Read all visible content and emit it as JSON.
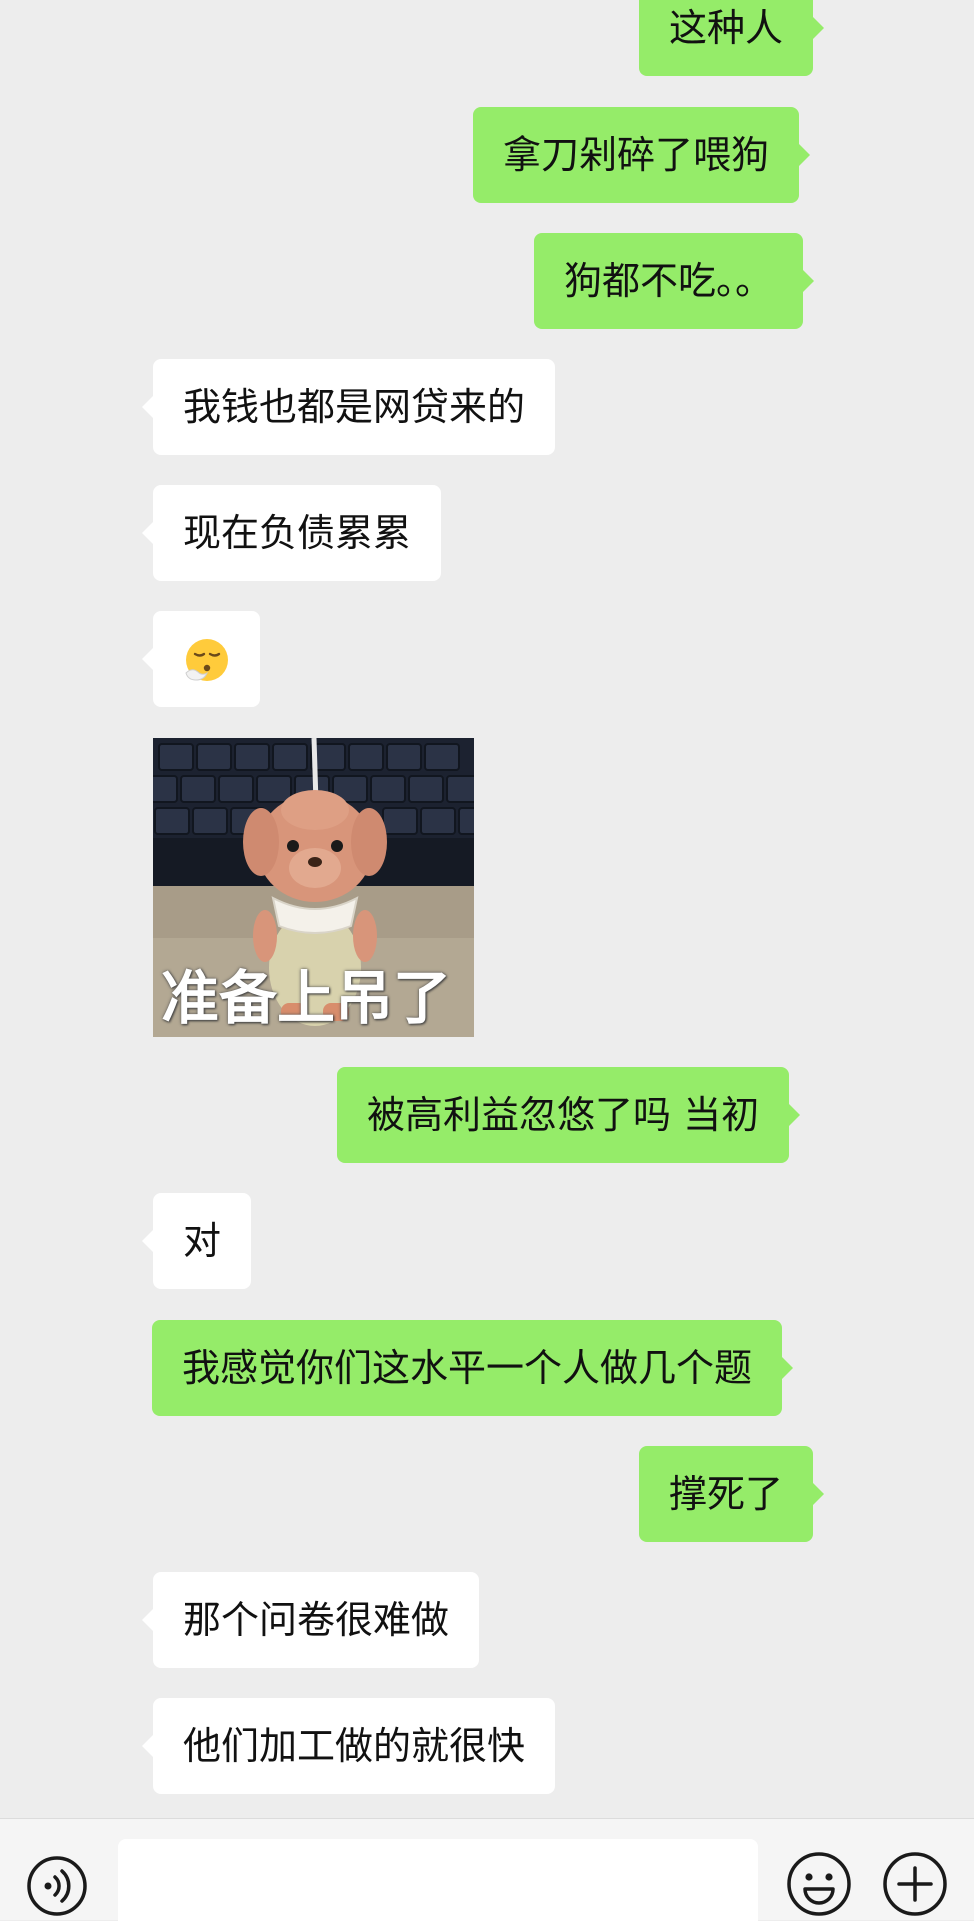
{
  "messages": [
    {
      "text": "这种人"
    },
    {
      "text": "拿刀剁碎了喂狗"
    },
    {
      "text": "狗都不吃。。"
    },
    {
      "text": "我钱也都是网贷来的"
    },
    {
      "text": "现在负债累累"
    },
    {
      "text": "被高利益忽悠了吗 当初"
    },
    {
      "text": "对"
    },
    {
      "text": "我感觉你们这水平一个人做几个题"
    },
    {
      "text": "撑死了"
    },
    {
      "text": "那个问卷很难做"
    },
    {
      "text": "他们加工做的就很快"
    }
  ],
  "emoji_message": {
    "icon": "face-exhaling-icon"
  },
  "sticker": {
    "caption": "准备上吊了"
  },
  "input_bar": {
    "voice_icon": "voice-icon",
    "input_value": "",
    "emoji_icon": "emoji-smile-icon",
    "plus_icon": "plus-circle-icon"
  },
  "colors": {
    "background": "#ededed",
    "outgoing_bubble": "#95ec69",
    "incoming_bubble": "#ffffff"
  }
}
